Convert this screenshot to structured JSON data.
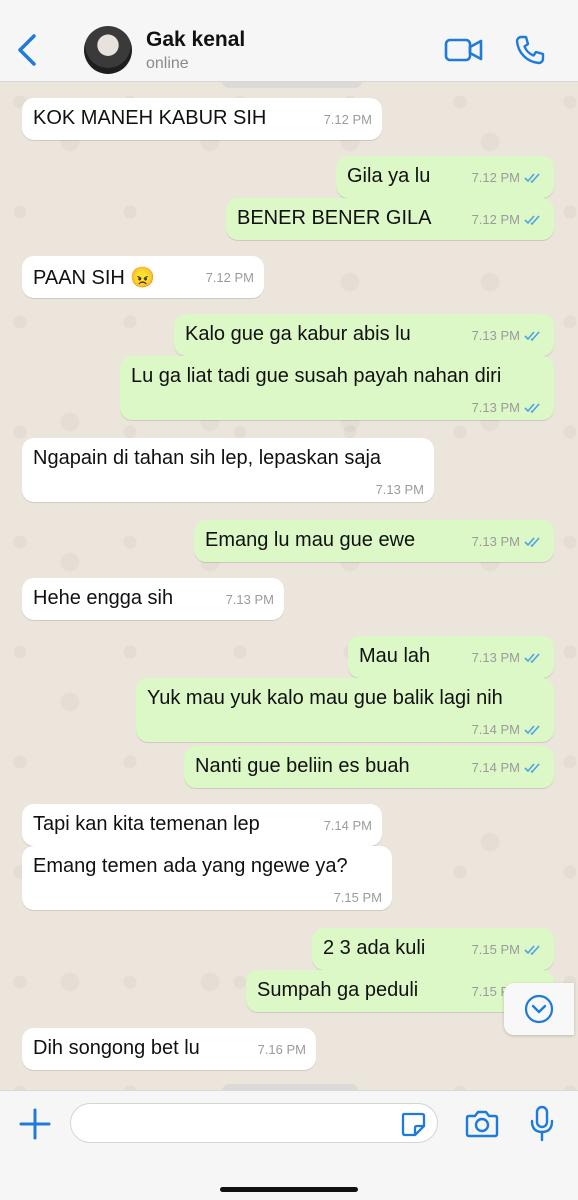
{
  "header": {
    "contact_name": "Gak kenal",
    "status": "online"
  },
  "colors": {
    "accent": "#1f7bd8",
    "incoming_bubble": "#ffffff",
    "outgoing_bubble": "#dcf8c6",
    "read_ticks": "#4fa3e0"
  },
  "messages": [
    {
      "dir": "in",
      "text": "KOK MANEH KABUR SIH",
      "time": "7.12 PM"
    },
    {
      "dir": "out",
      "text": "Gila ya lu",
      "time": "7.12 PM"
    },
    {
      "dir": "out",
      "text": "BENER BENER GILA",
      "time": "7.12 PM"
    },
    {
      "dir": "in",
      "text": "PAAN SIH 😠",
      "time": "7.12 PM"
    },
    {
      "dir": "out",
      "text": "Kalo gue ga kabur abis lu",
      "time": "7.13 PM"
    },
    {
      "dir": "out",
      "text": "Lu ga liat tadi gue susah payah nahan diri",
      "time": "7.13 PM"
    },
    {
      "dir": "in",
      "text": "Ngapain di tahan sih lep, lepaskan saja",
      "time": "7.13 PM"
    },
    {
      "dir": "out",
      "text": "Emang lu mau gue ewe",
      "time": "7.13 PM"
    },
    {
      "dir": "in",
      "text": "Hehe engga sih",
      "time": "7.13 PM"
    },
    {
      "dir": "out",
      "text": "Mau lah",
      "time": "7.13 PM"
    },
    {
      "dir": "out",
      "text": "Yuk mau yuk kalo mau gue balik lagi nih",
      "time": "7.14 PM"
    },
    {
      "dir": "out",
      "text": "Nanti gue beliin es buah",
      "time": "7.14 PM"
    },
    {
      "dir": "in",
      "text": "Tapi kan kita temenan lep",
      "time": "7.14 PM"
    },
    {
      "dir": "in",
      "text": "Emang temen ada yang ngewe ya?",
      "time": "7.15 PM"
    },
    {
      "dir": "out",
      "text": "2 3 ada kuli",
      "time": "7.15 PM"
    },
    {
      "dir": "out",
      "text": "Sumpah ga peduli",
      "time": "7.15 PM"
    },
    {
      "dir": "in",
      "text": "Dih songong bet lu",
      "time": "7.16 PM"
    }
  ],
  "composer": {
    "value": ""
  }
}
